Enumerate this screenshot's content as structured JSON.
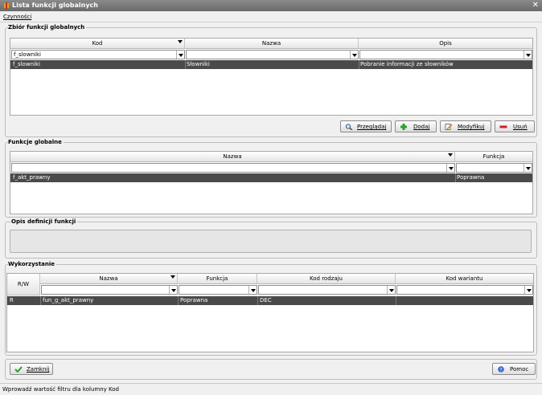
{
  "window": {
    "title": "Lista funkcji globalnych",
    "close": "✕"
  },
  "menu": {
    "czynnosci": "Czynności"
  },
  "zbior": {
    "label": "Zbiór funkcji globalnych",
    "columns": [
      "Kod",
      "Nazwa",
      "Opis"
    ],
    "filter_kod": "f_slowniki",
    "row": {
      "kod": "f_slowniki",
      "nazwa": "Słowniki",
      "opis": "Pobranie informacji ze słowników"
    }
  },
  "buttons": {
    "przegladaj": "Przeglądaj",
    "dodaj": "Dodaj",
    "modyfikuj": "Modyfikuj",
    "usun": "Usuń"
  },
  "funkcje": {
    "label": "Funkcje globalne",
    "columns": [
      "Nazwa",
      "Funkcja"
    ],
    "row": {
      "nazwa": "f_akt_prawny",
      "funkcja": "Poprawna"
    }
  },
  "opis": {
    "label": "Opis definicji funkcji"
  },
  "wykorzystanie": {
    "label": "Wykorzystanie",
    "columns": [
      "R/W",
      "Nazwa",
      "Funkcja",
      "Kod rodzaju",
      "Kod wariantu"
    ],
    "row": {
      "rw": "R",
      "nazwa": "fun_g_akt_prawny",
      "funkcja": "Poprawna",
      "kod_rodzaju": "DEC",
      "kod_wariantu": ""
    }
  },
  "footer": {
    "zamknij": "Zamknij",
    "pomoc": "Pomoc"
  },
  "status": "Wprowadź wartość filtru dla kolumny Kod",
  "colors": {
    "titlebar": "#7a7a7a",
    "selected_row": "#4a4a4a",
    "dodaj_icon": "#2aa02a",
    "usun_icon": "#d02020"
  }
}
